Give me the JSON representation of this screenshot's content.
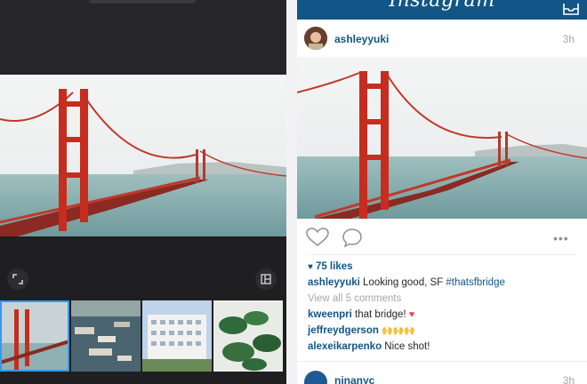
{
  "app": {
    "title": "Instagram"
  },
  "post": {
    "username": "ashleyyuki",
    "time": "3h",
    "likes": "75 likes",
    "caption_user": "ashleyyuki",
    "caption_text": " Looking good, SF ",
    "caption_tag": "#thatsfbridge",
    "view_all": "View all 5 comments",
    "comments": [
      {
        "user": "kweenpri",
        "text": " that bridge! ",
        "emoji": "♥"
      },
      {
        "user": "jeffreydgerson",
        "text": " ",
        "emoji": "🙌🙌🙌"
      },
      {
        "user": "alexeikarpenko",
        "text": " Nice shot!",
        "emoji": ""
      }
    ]
  },
  "next_post": {
    "username": "ninanyc",
    "time": "3h"
  },
  "icons": {
    "expand": "expand-icon",
    "layout": "layout-icon",
    "inbox": "inbox-icon",
    "heart": "heart-outline-icon",
    "comment": "comment-bubble-icon",
    "more": "more-dots-icon"
  },
  "colors": {
    "brand": "#125688",
    "editor_bg": "#1f1f21",
    "selection": "#3897f0"
  }
}
